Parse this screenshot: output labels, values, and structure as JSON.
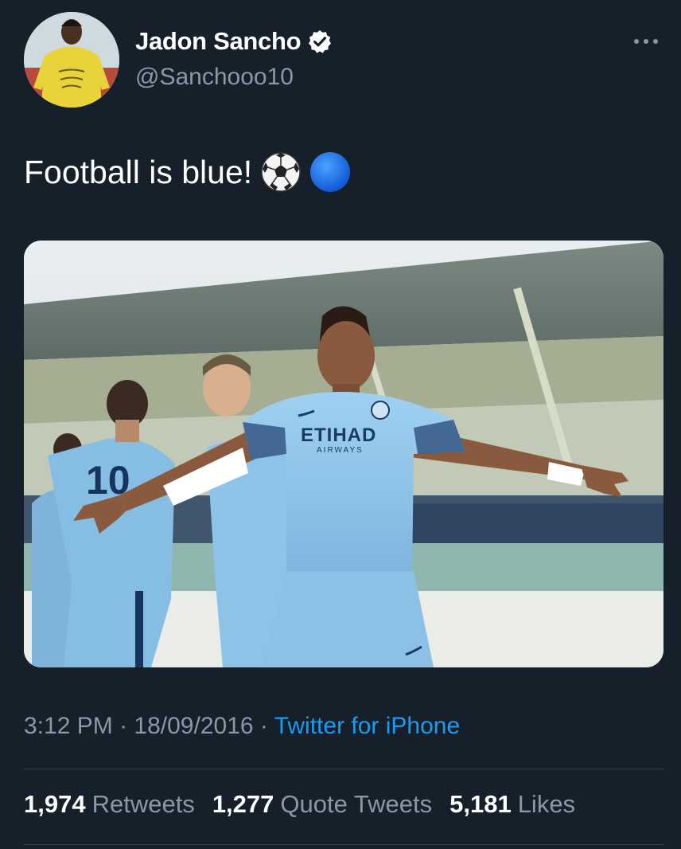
{
  "user": {
    "display_name": "Jadon Sancho",
    "handle": "@Sanchooo10",
    "verified": true
  },
  "tweet": {
    "text": "Football is blue!",
    "emojis": [
      "soccer-ball-icon",
      "blue-circle-icon"
    ]
  },
  "media": {
    "shirt_sponsor": "ETIHAD",
    "shirt_sponsor_sub": "AIRWAYS",
    "shirt_number": "10"
  },
  "meta": {
    "time": "3:12 PM",
    "date": "18/09/2016",
    "separator": "·",
    "source": "Twitter for iPhone"
  },
  "stats": {
    "retweets_count": "1,974",
    "retweets_label": "Retweets",
    "quotes_count": "1,277",
    "quotes_label": "Quote Tweets",
    "likes_count": "5,181",
    "likes_label": "Likes"
  },
  "colors": {
    "background": "#15202b",
    "secondary_text": "#8b98a5",
    "link": "#1d9bf0",
    "divider": "#38444d",
    "kit_blue": "#8ec3e8"
  }
}
